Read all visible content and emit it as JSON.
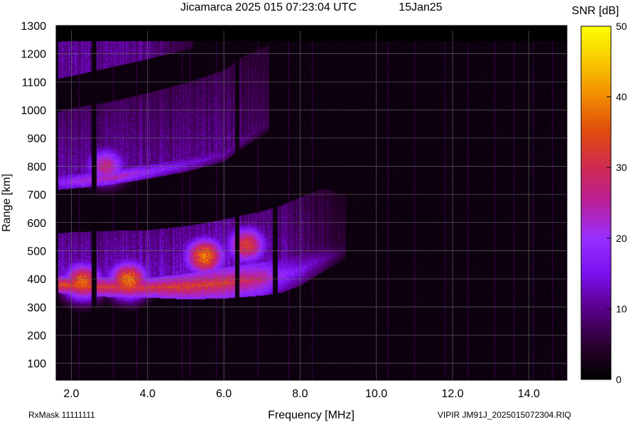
{
  "chart_data": {
    "type": "heatmap",
    "title": "Jicamarca 2025 015 07:23:04 UTC",
    "date_label": "15Jan25",
    "xlabel": "Frequency [MHz]",
    "ylabel": "Range [km]",
    "xlim": [
      1.6,
      15.0
    ],
    "ylim": [
      40,
      1300
    ],
    "data_range_top": 1245,
    "x_ticks": [
      2.0,
      4.0,
      6.0,
      8.0,
      10.0,
      12.0,
      14.0
    ],
    "x_tick_labels": [
      "2.0",
      "4.0",
      "6.0",
      "8.0",
      "10.0",
      "12.0",
      "14.0"
    ],
    "y_ticks": [
      100,
      200,
      300,
      400,
      500,
      600,
      700,
      800,
      900,
      1000,
      1100,
      1200,
      1300
    ],
    "y_tick_labels": [
      "100",
      "200",
      "300",
      "400",
      "500",
      "600",
      "700",
      "800",
      "900",
      "1000",
      "1100",
      "1200",
      "1300"
    ],
    "grid": true,
    "colorbar": {
      "label": "SNR [dB]",
      "range": [
        0,
        50
      ],
      "ticks": [
        0,
        10,
        20,
        30,
        40,
        50
      ],
      "tick_labels": [
        "0",
        "10",
        "20",
        "30",
        "40",
        "50"
      ],
      "colormap": [
        "#000000",
        "#2a0030",
        "#5a008a",
        "#7b10f0",
        "#9830ff",
        "#b81f9a",
        "#cf2a50",
        "#e04a10",
        "#f08a00",
        "#f8c800",
        "#ffff00"
      ]
    },
    "traces": {
      "f_layer_1hop": {
        "freq_mhz": [
          1.6,
          2.0,
          3.0,
          4.0,
          5.0,
          6.0,
          7.0,
          7.5,
          8.0,
          8.6,
          9.2
        ],
        "range_km": [
          380,
          376,
          370,
          368,
          372,
          385,
          400,
          410,
          430,
          470,
          500
        ],
        "snr_db": [
          36,
          35,
          33,
          32,
          34,
          33,
          28,
          20,
          16,
          12,
          6
        ],
        "thickness_km": [
          30,
          30,
          35,
          35,
          45,
          55,
          60,
          60,
          55,
          45,
          30
        ],
        "halo_km": [
          180,
          190,
          200,
          205,
          215,
          225,
          240,
          250,
          260,
          250,
          200
        ],
        "halo_snr_db": [
          14,
          14,
          14,
          14,
          15,
          15,
          13,
          12,
          10,
          8,
          5
        ]
      },
      "f_layer_2hop": {
        "freq_mhz": [
          1.6,
          2.0,
          3.0,
          4.0,
          5.0,
          6.0,
          6.5,
          7.2
        ],
        "range_km": [
          740,
          745,
          758,
          780,
          805,
          840,
          890,
          950
        ],
        "snr_db": [
          18,
          22,
          26,
          21,
          16,
          12,
          10,
          7
        ],
        "halo_km": [
          250,
          260,
          270,
          280,
          290,
          300,
          300,
          280
        ],
        "halo_snr_db": [
          12,
          12,
          12,
          11,
          11,
          10,
          9,
          7
        ]
      },
      "high_range_band": {
        "freq_mhz": [
          1.6,
          2.0,
          3.0,
          4.0,
          4.6,
          5.2
        ],
        "range_km": [
          1130,
          1140,
          1170,
          1200,
          1220,
          1240
        ],
        "halo_km": [
          110,
          110,
          100,
          90,
          80,
          60
        ],
        "halo_snr_db": [
          10,
          11,
          11,
          10,
          8,
          5
        ]
      },
      "hotspots": [
        {
          "freq_mhz": 2.3,
          "range_km": 390,
          "snr_db": 38
        },
        {
          "freq_mhz": 3.5,
          "range_km": 395,
          "snr_db": 40
        },
        {
          "freq_mhz": 5.5,
          "range_km": 480,
          "snr_db": 40
        },
        {
          "freq_mhz": 6.6,
          "range_km": 520,
          "snr_db": 34
        },
        {
          "freq_mhz": 2.9,
          "range_km": 800,
          "snr_db": 28
        }
      ],
      "dark_columns_mhz": [
        1.6,
        2.6,
        6.35,
        7.35
      ],
      "narrow_interference_mhz": [
        2.2,
        3.1,
        3.7,
        4.9,
        5.1,
        5.8,
        6.0,
        6.9,
        7.7,
        8.3,
        10.3,
        11.0,
        11.8,
        12.4,
        13.1,
        13.6,
        14.1,
        14.6
      ]
    }
  },
  "footer": {
    "left": "RxMask 11111111",
    "right": "VIPIR  JM91J_2025015072304.RIQ"
  }
}
